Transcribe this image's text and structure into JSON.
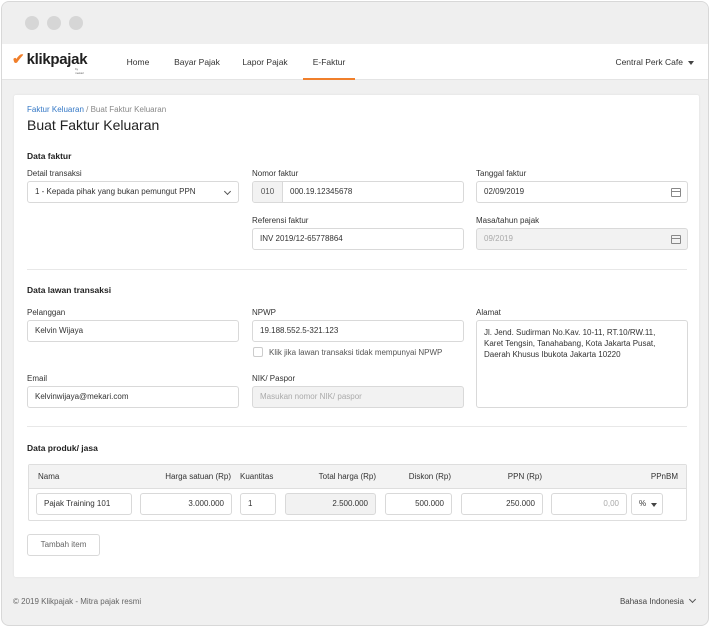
{
  "nav": {
    "logo_text": "klikpajak",
    "logo_sub": "by mekari",
    "items": [
      "Home",
      "Bayar Pajak",
      "Lapor Pajak",
      "E-Faktur"
    ],
    "active_item": "E-Faktur",
    "company": "Central Perk Cafe"
  },
  "breadcrumb": {
    "link": "Faktur Keluaran",
    "separator": " / ",
    "current": "Buat Faktur Keluaran"
  },
  "page_title": "Buat Faktur Keluaran",
  "data_faktur": {
    "title": "Data faktur",
    "detail_transaksi": {
      "label": "Detail transaksi",
      "value": "1 - Kepada pihak yang bukan pemungut PPN"
    },
    "nomor_faktur": {
      "label": "Nomor faktur",
      "prefix": "010",
      "value": "000.19.12345678"
    },
    "tanggal_faktur": {
      "label": "Tanggal faktur",
      "value": "02/09/2019"
    },
    "referensi_faktur": {
      "label": "Referensi faktur",
      "value": "INV 2019/12-65778864"
    },
    "masa_tahun_pajak": {
      "label": "Masa/tahun pajak",
      "value": "09/2019"
    }
  },
  "data_lawan": {
    "title": "Data lawan transaksi",
    "pelanggan": {
      "label": "Pelanggan",
      "value": "Kelvin Wijaya"
    },
    "npwp": {
      "label": "NPWP",
      "value": "19.188.552.5-321.123",
      "checkbox_label": "Klik jika lawan transaksi tidak mempunyai NPWP"
    },
    "alamat": {
      "label": "Alamat",
      "lines": [
        "Jl. Jend. Sudirman No.Kav. 10-11, RT.10/RW.11,",
        "Karet Tengsin, Tanahabang, Kota Jakarta Pusat,",
        "Daerah Khusus Ibukota Jakarta 10220"
      ]
    },
    "email": {
      "label": "Email",
      "value": "Kelvinwijaya@mekari.com"
    },
    "nik": {
      "label": "NIK/ Paspor",
      "placeholder": "Masukan nomor NIK/ paspor"
    }
  },
  "data_produk": {
    "title": "Data produk/ jasa",
    "headers": [
      "Nama",
      "Harga satuan (Rp)",
      "Kuantitas",
      "Total harga (Rp)",
      "Diskon (Rp)",
      "PPN (Rp)",
      "PPnBM"
    ],
    "row": {
      "nama": "Pajak Training 101",
      "harga_satuan": "3.000.000",
      "kuantitas": "1",
      "total_harga": "2.500.000",
      "diskon": "500.000",
      "ppn": "250.000",
      "ppnbm": "0,00",
      "ppnbm_unit": "%"
    },
    "add_button": "Tambah item"
  },
  "footer": {
    "copyright": "© 2019 Klikpajak - Mitra pajak resmi",
    "language": "Bahasa Indonesia"
  },
  "colors": {
    "accent": "#f07f2b",
    "link": "#3478c6"
  }
}
